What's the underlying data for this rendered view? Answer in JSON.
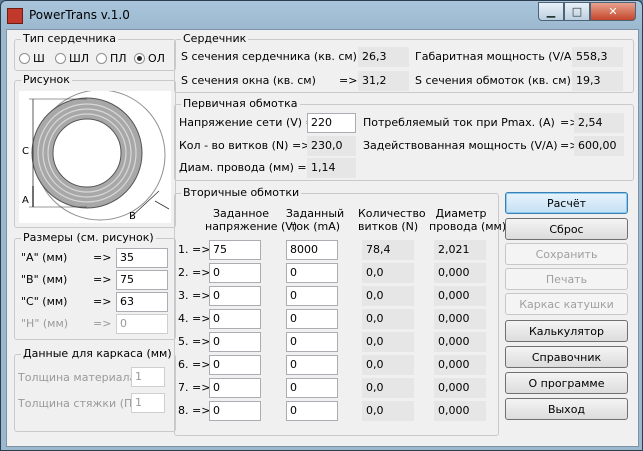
{
  "window": {
    "title": "PowerTrans v.1.0"
  },
  "core_type": {
    "legend": "Тип сердечника",
    "options": [
      {
        "label": "Ш",
        "selected": false
      },
      {
        "label": "ШЛ",
        "selected": false
      },
      {
        "label": "ПЛ",
        "selected": false
      },
      {
        "label": "ОЛ",
        "selected": true
      }
    ]
  },
  "picture": {
    "legend": "Рисунок",
    "labels": {
      "a": "A",
      "b": "B",
      "c": "C"
    }
  },
  "sizes": {
    "legend": "Размеры (см. рисунок)",
    "rows": [
      {
        "label": "\"A\" (мм)",
        "arrow": "=>",
        "value": "35"
      },
      {
        "label": "\"B\" (мм)",
        "arrow": "=>",
        "value": "75"
      },
      {
        "label": "\"C\" (мм)",
        "arrow": "=>",
        "value": "63"
      },
      {
        "label": "\"H\" (мм)",
        "arrow": "=>",
        "value": "0"
      }
    ]
  },
  "frame": {
    "legend": "Данные для каркаса (мм)",
    "thickness_label": "Толщина материала",
    "thickness_value": "1",
    "tie_label": "Толщина стяжки (ПЛ)",
    "tie_value": "1"
  },
  "core": {
    "legend": "Сердечник",
    "section_label": "S сечения сердечника (кв. см) =>",
    "section_value": "26,3",
    "window_label": "S сечения окна (кв. см)",
    "window_arrow": "=>",
    "window_value": "31,2",
    "power_label": "Габаритная мощность (V/A) =>",
    "power_value": "558,3",
    "winding_label": "S сечения обмоток (кв. см) =>",
    "winding_value": "19,3"
  },
  "primary": {
    "legend": "Первичная обмотка",
    "voltage_label": "Напряжение сети (V) =>",
    "voltage_value": "220",
    "turns_label": "Кол - во витков (N) =>",
    "turns_value": "230,0",
    "diam_label": "Диам. провода (мм) =>",
    "diam_value": "1,14",
    "current_label": "Потребляемый ток при Pmax. (A)",
    "current_arrow": "=>",
    "current_value": "2,54",
    "used_power_label": "Задействованная мощность (V/A)",
    "used_power_arrow": "=>",
    "used_power_value": "600,00"
  },
  "secondary": {
    "legend": "Вторичные обмотки",
    "headers": {
      "voltage_l1": "Заданное",
      "voltage_l2": "напряжение (V)",
      "current_l1": "Заданный",
      "current_l2": "ток (mA)",
      "turns_l1": "Количество",
      "turns_l2": "витков (N)",
      "diam_l1": "Диаметр",
      "diam_l2": "провода (мм)"
    },
    "rows": [
      {
        "label": "1. =>",
        "voltage": "75",
        "current": "8000",
        "turns": "78,4",
        "diam": "2,021"
      },
      {
        "label": "2. =>",
        "voltage": "0",
        "current": "0",
        "turns": "0,0",
        "diam": "0,000"
      },
      {
        "label": "3. =>",
        "voltage": "0",
        "current": "0",
        "turns": "0,0",
        "diam": "0,000"
      },
      {
        "label": "4. =>",
        "voltage": "0",
        "current": "0",
        "turns": "0,0",
        "diam": "0,000"
      },
      {
        "label": "5. =>",
        "voltage": "0",
        "current": "0",
        "turns": "0,0",
        "diam": "0,000"
      },
      {
        "label": "6. =>",
        "voltage": "0",
        "current": "0",
        "turns": "0,0",
        "diam": "0,000"
      },
      {
        "label": "7. =>",
        "voltage": "0",
        "current": "0",
        "turns": "0,0",
        "diam": "0,000"
      },
      {
        "label": "8. =>",
        "voltage": "0",
        "current": "0",
        "turns": "0,0",
        "diam": "0,000"
      }
    ]
  },
  "buttons": [
    {
      "name": "calculate-button",
      "label": "Расчёт",
      "state": "primary"
    },
    {
      "name": "reset-button",
      "label": "Сброс",
      "state": "normal"
    },
    {
      "name": "save-button",
      "label": "Сохранить",
      "state": "disabled"
    },
    {
      "name": "print-button",
      "label": "Печать",
      "state": "disabled"
    },
    {
      "name": "coil-frame-button",
      "label": "Каркас катушки",
      "state": "disabled"
    },
    {
      "name": "calculator-button",
      "label": "Калькулятор",
      "state": "normal"
    },
    {
      "name": "reference-button",
      "label": "Справочник",
      "state": "normal"
    },
    {
      "name": "about-button",
      "label": "О программе",
      "state": "normal"
    },
    {
      "name": "exit-button",
      "label": "Выход",
      "state": "normal"
    }
  ],
  "colors": {
    "accent": "#3c7fb1",
    "close_button": "#c4462b",
    "readonly_bg": "#e6e6e6"
  }
}
